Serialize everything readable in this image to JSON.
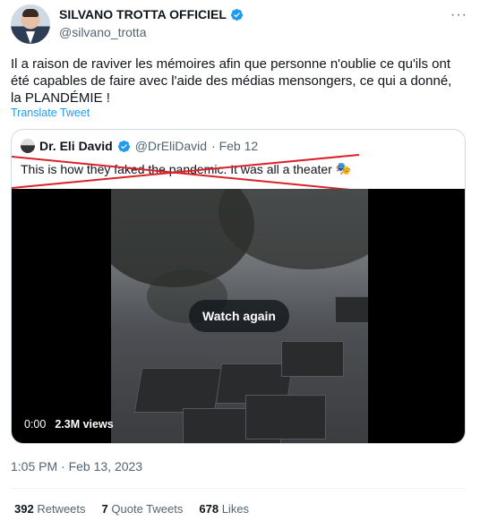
{
  "author": {
    "display_name": "SILVANO TROTTA OFFICIEL",
    "handle": "@silvano_trotta",
    "verified": true,
    "avatar": "avatar"
  },
  "more_icon": "more-options-icon",
  "tweet": {
    "text": "Il a raison de raviver les mémoires afin que personne n'oublie ce qu'ils ont été capables de faire avec l'aide des médias mensongers, ce qui a donné, la PLANDÉMIE !",
    "translate_label": "Translate Tweet",
    "timestamp": "1:05 PM · Feb 13, 2023"
  },
  "quoted_tweet": {
    "display_name": "Dr. Eli David",
    "handle": "@DrEliDavid",
    "date": "· Feb 12",
    "text": "This is how they faked the pandemic. It was all a theater",
    "emoji": "🎭",
    "video": {
      "overlay_label": "Watch again",
      "time": "0:00",
      "views": "2.3M views"
    }
  },
  "stats": {
    "retweets_count": "392",
    "retweets_label": "Retweets",
    "quotes_count": "7",
    "quotes_label": "Quote Tweets",
    "likes_count": "678",
    "likes_label": "Likes"
  },
  "colors": {
    "link": "#1d9bf0",
    "secondary_text": "#536471",
    "cross_out": "#d8232a"
  }
}
